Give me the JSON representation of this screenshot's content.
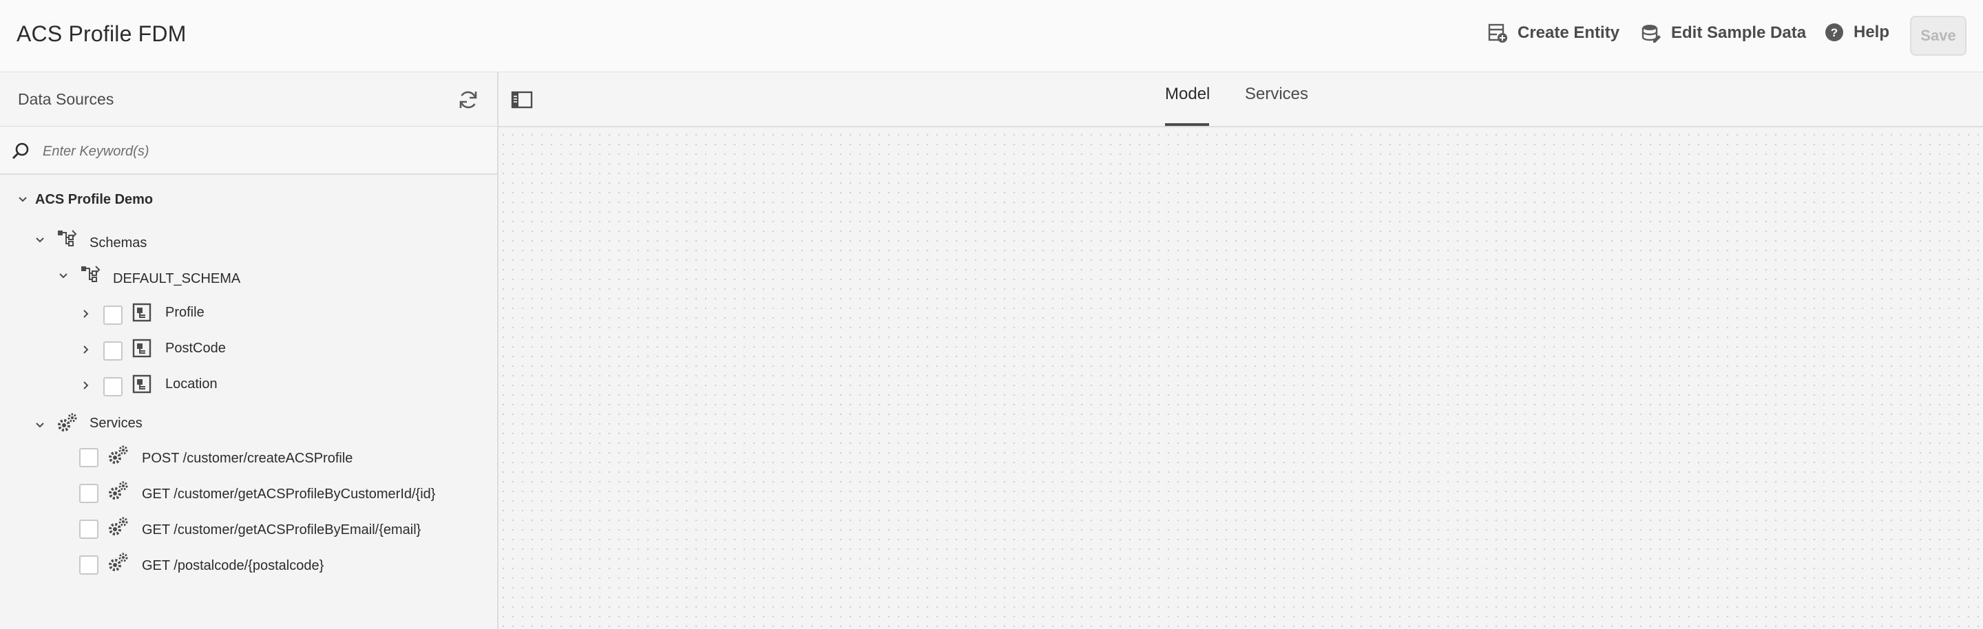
{
  "header": {
    "title": "ACS Profile FDM",
    "create_entity": "Create Entity",
    "edit_sample_data": "Edit Sample Data",
    "help": "Help",
    "save": "Save"
  },
  "sidebar": {
    "title": "Data Sources",
    "search_placeholder": "Enter Keyword(s)",
    "root": "ACS Profile Demo",
    "schemas_label": "Schemas",
    "schema_name": "DEFAULT_SCHEMA",
    "entities": [
      "Profile",
      "PostCode",
      "Location"
    ],
    "services_label": "Services",
    "services": [
      "POST /customer/createACSProfile",
      "GET /customer/getACSProfileByCustomerId/{id}",
      "GET /customer/getACSProfileByEmail/{email}",
      "GET /postalcode/{postalcode}"
    ]
  },
  "main": {
    "tabs": [
      "Model",
      "Services"
    ],
    "active_tab": "Model"
  },
  "colors": {
    "text": "#2c2c2c",
    "muted": "#4b4b4b",
    "canvas_dots": "#cfcfcf"
  }
}
